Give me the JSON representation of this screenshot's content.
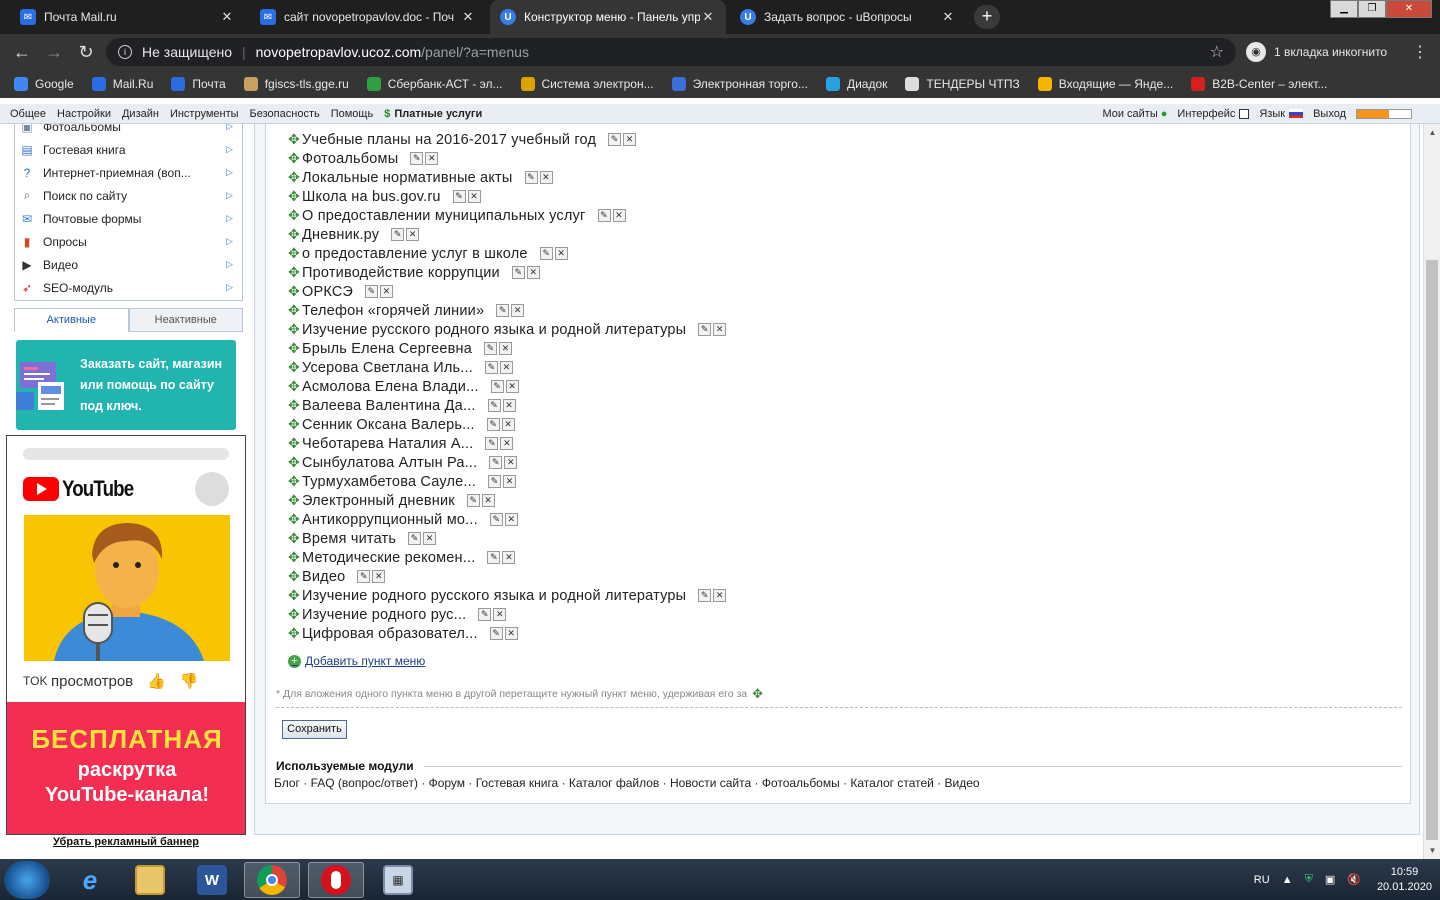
{
  "browser": {
    "tabs": [
      {
        "title": "Почта Mail.ru",
        "favicon": "mail-icon",
        "color": "#2b6de0"
      },
      {
        "title": "сайт novopetropavlov.doc - Поч",
        "favicon": "mail-icon",
        "color": "#2b6de0"
      },
      {
        "title": "Конструктор меню - Панель упр",
        "favicon": "ucoz-icon",
        "color": "#3b7be8"
      },
      {
        "title": "Задать вопрос - uВопросы",
        "favicon": "ucoz-icon",
        "color": "#3b7be8"
      }
    ],
    "new_tab": "+",
    "not_secure": "Не защищено",
    "url_host": "novopetropavlov.ucoz.com",
    "url_path": "/panel/?a=menus",
    "incognito": "1 вкладка инкогнито",
    "bookmarks": [
      {
        "label": "Google",
        "color": "#4285f4"
      },
      {
        "label": "Mail.Ru",
        "color": "#2b6de0"
      },
      {
        "label": "Почта",
        "color": "#2b6de0"
      },
      {
        "label": "fgiscs-tls.gge.ru",
        "color": "#c8a060"
      },
      {
        "label": "Сбербанк-АСТ - эл...",
        "color": "#2ea043"
      },
      {
        "label": "Система электрон...",
        "color": "#d9a400"
      },
      {
        "label": "Электронная торго...",
        "color": "#3a6fd8"
      },
      {
        "label": "Диадок",
        "color": "#2aa0e0"
      },
      {
        "label": "ТЕНДЕРЫ ЧТПЗ",
        "color": "#dddddd"
      },
      {
        "label": "Входящие — Янде...",
        "color": "#f5b400"
      },
      {
        "label": "B2B-Center – элект...",
        "color": "#d61f1f"
      }
    ]
  },
  "panel_top": {
    "menu": [
      "Общее",
      "Настройки",
      "Дизайн",
      "Инструменты",
      "Безопасность",
      "Помощь"
    ],
    "paid": "Платные услуги",
    "right": {
      "my_sites": "Мои сайты",
      "interface": "Интерфейс",
      "language": "Язык",
      "logout": "Выход"
    },
    "progress": 0.6
  },
  "sidebar": {
    "items": [
      {
        "label": "Фотоальбомы",
        "icon": "photo-icon"
      },
      {
        "label": "Гостевая книга",
        "icon": "guestbook-icon"
      },
      {
        "label": "Интернет-приемная (воп...",
        "icon": "question-icon"
      },
      {
        "label": "Поиск по сайту",
        "icon": "search-icon"
      },
      {
        "label": "Почтовые формы",
        "icon": "mail-form-icon"
      },
      {
        "label": "Опросы",
        "icon": "poll-chart-icon"
      },
      {
        "label": "Видео",
        "icon": "video-icon"
      },
      {
        "label": "SEO-модуль",
        "icon": "rocket-icon"
      }
    ],
    "tab_active": "Активные",
    "tab_inactive": "Неактивные",
    "promo": "Заказать сайт, магазин или помощь по сайту под ключ.",
    "yt_logo": "YouTube",
    "yt_stats": "просмотров",
    "yt_line1": "БЕСПЛАТНАЯ",
    "yt_line2": "раскрутка",
    "yt_line3": "YouTube-канала!",
    "remove_banner": "Убрать рекламный баннер"
  },
  "menu_items": [
    "Учебные планы на 2016-2017 учебный год",
    "Фотоальбомы",
    "Локальные нормативные акты",
    "Школа на bus.gov.ru",
    "О предоставлении муниципальных услуг",
    "Дневник.ру",
    "о предоставление услуг в школе",
    "Противодействие коррупции",
    "ОРКСЭ",
    "Телефон «горячей линии»",
    "Изучение русского родного языка и родной литературы",
    "Брыль Елена Сергеевна",
    "Усерова Светлана Иль...",
    "Асмолова Елена Влади...",
    "Валеева Валентина Да...",
    "Сенник Оксана Валерь...",
    "Чеботарева Наталия А...",
    "Сынбулатова Алтын Ра...",
    "Турмухамбетова Сауле...",
    "Электронный дневник",
    "Антикоррупционный мо...",
    "Время читать",
    "Методические рекомен...",
    "Видео",
    "Изучение родного русского языка и родной литературы",
    "Изучение родного рус...",
    "Цифровая образовател..."
  ],
  "add_item": "Добавить пункт меню",
  "hint": "* Для вложения одного пункта меню в другой перетащите нужный пункт меню, удерживая его за",
  "save": "Сохранить",
  "modules_title": "Используемые модули",
  "modules": "Блог · FAQ (вопрос/ответ) · Форум · Гостевая книга · Каталог файлов · Новости сайта · Фотоальбомы · Каталог статей · Видео",
  "tray": {
    "lang": "RU",
    "time": "10:59",
    "date": "20.01.2020"
  }
}
